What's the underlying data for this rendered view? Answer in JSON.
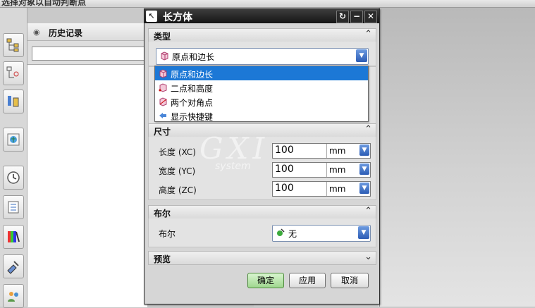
{
  "status_bar": {
    "text": "选择对象以自动判断点"
  },
  "history": {
    "title": "历史记录",
    "search_value": ""
  },
  "dialog": {
    "title": "长方体",
    "sections": {
      "type": {
        "label": "类型",
        "selected": "原点和边长"
      },
      "dimensions": {
        "label": "尺寸",
        "rows": [
          {
            "label": "长度 (XC)",
            "value": "100",
            "unit": "mm"
          },
          {
            "label": "宽度 (YC)",
            "value": "100",
            "unit": "mm"
          },
          {
            "label": "高度 (ZC)",
            "value": "100",
            "unit": "mm"
          }
        ]
      },
      "boolean": {
        "label": "布尔",
        "field_label": "布尔",
        "selected": "无"
      },
      "preview": {
        "label": "预览"
      }
    },
    "buttons": {
      "ok": "确定",
      "apply": "应用",
      "cancel": "取消"
    }
  },
  "type_dropdown": {
    "options": [
      "原点和边长",
      "二点和高度",
      "两个对角点",
      "显示快捷键"
    ],
    "highlighted": "原点和边长"
  },
  "watermark": {
    "main": "GXI",
    "sub": "system"
  },
  "colors": {
    "highlight": "#1c78d6",
    "ok_button": "#9fd78f",
    "titlebar": "#151515"
  }
}
